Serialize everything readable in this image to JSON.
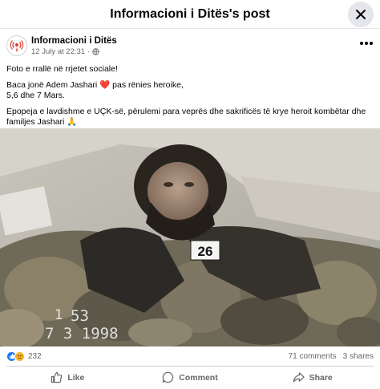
{
  "dialog": {
    "title": "Informacioni i Ditës's post"
  },
  "post": {
    "page_name": "Informacioni i Ditës",
    "date": "12 July at 22:31",
    "separator": "·",
    "text": {
      "p1": "Foto e rrallë në rrjetet sociale!",
      "p2_line1": "Baca jonë Adem Jashari ❤️ pas rënies heroike,",
      "p2_line2": "5,6 dhe 7 Mars.",
      "p3": "Epopeja e lavdishme e UÇK-së, përulemi para veprës dhe sakrificës të krye heroit kombëtar dhe familjes Jashari 🙏"
    },
    "photo": {
      "stamp_time": "53",
      "stamp_prefix": "1",
      "stamp_date": "7 3 1998",
      "tag_number": "26"
    }
  },
  "reactions": {
    "count": "232",
    "comments": "71 comments",
    "shares": "3 shares"
  },
  "actions": {
    "like": "Like",
    "comment": "Comment",
    "share": "Share"
  },
  "colors": {
    "accent_blue": "#1877f2",
    "sad_yellow": "#f7b125",
    "heart_red": "#e41e3f",
    "meta_gray": "#65676b"
  }
}
